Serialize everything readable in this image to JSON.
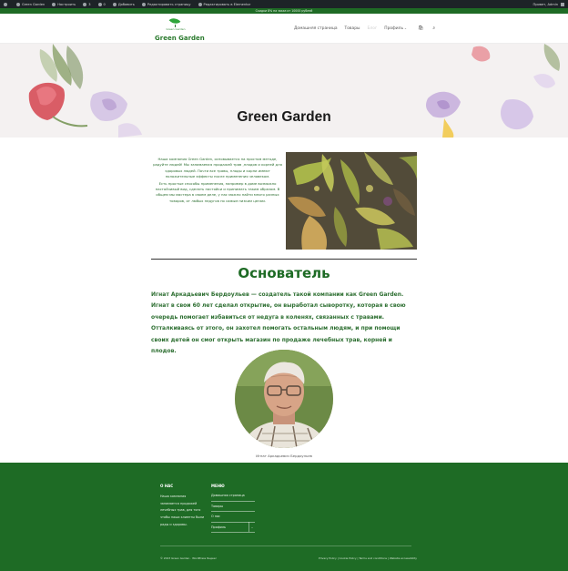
{
  "adminbar": {
    "items": [
      "Green Garden",
      "Настроить",
      "3",
      "0",
      "Добавить",
      "Редактировать страницу",
      "Редактировать в Elementor"
    ],
    "greeting": "Привет, Admin"
  },
  "promo": {
    "text": "Скидки 8% на заказ от 10000 рублей"
  },
  "header": {
    "logo_small": "Green Garden",
    "logo_big": "Green Garden",
    "nav": {
      "home": "Домашняя страница",
      "goods": "Товары",
      "faded": "Блог",
      "profile": "Профиль"
    }
  },
  "hero": {
    "title": "Green Garden"
  },
  "intro": {
    "p1": "Наша компания Green Garden, основывается на простом методе, радуйте людей! Мы занимаемся продажей трав ,плодов и корней для здоровых людей. Почти все травы, плоды и корни имеют положительные эффекты после применения человеком.",
    "p2": "Есть простые способы применения, например в доме возможно настойчивый вид, сделать настойки и принимать таким образом. В общем мы мастера в своем деле, у нас можно найти много разных товаров, от любых недугов по самым низким ценам."
  },
  "founder": {
    "title": "Основатель",
    "text": "Игнат Аркадьевич Бердоульев — создатель такой компании как Green Garden. Игнат в свои 60 лет сделал открытие, он выработал сыворотку, которая в свою очередь помогает избавиться от недуга в коленях, связанных с травами. Отталкиваясь от этого, он захотел помогать остальным людям, и при помощи своих детей он смог открыть  магазин по продаже лечебных трав, корней и плодов.",
    "caption": "Игнат Аркадьевич Бердоульев"
  },
  "footer": {
    "about_heading": "О НАС",
    "about_text": "Наша компания занимается продажей лечебных трав, для того чтобы наши клиенты были рады и здоровы.",
    "menu_heading": "МЕНЮ",
    "menu": [
      "Домашняя страница",
      "Товары",
      "О нас",
      "Профиль"
    ],
    "copyright": "© 2023 Green Garden · WordPress Яндекс",
    "links": "Privacy Policy | Cookie Policy | Terms and conditions | Website accessibility"
  },
  "colors": {
    "brand_green": "#1e6b25",
    "text_green": "#2c6e30",
    "admin_dark": "#1d2327"
  }
}
